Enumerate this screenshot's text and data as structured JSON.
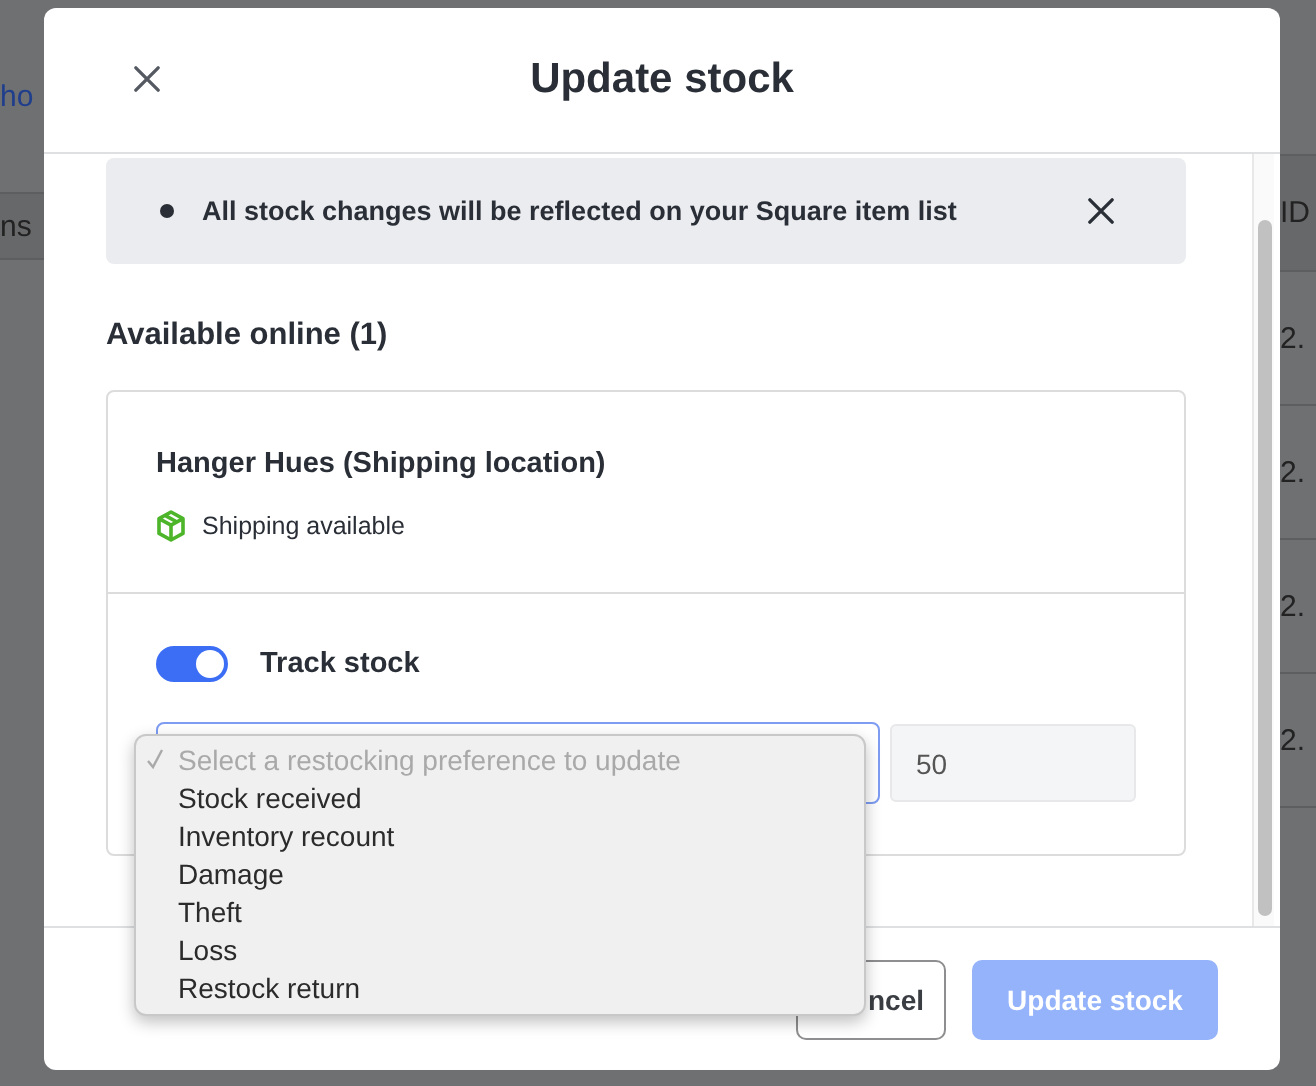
{
  "background_page": {
    "left": [
      {
        "text": "ho",
        "kind": "link"
      },
      {
        "text": "ns",
        "kind": "header"
      }
    ],
    "right": [
      {
        "text": "ID",
        "kind": "header"
      },
      {
        "text": "2.",
        "kind": "cell"
      },
      {
        "text": "2.",
        "kind": "cell"
      },
      {
        "text": "2.",
        "kind": "cell"
      },
      {
        "text": "2.",
        "kind": "cell"
      }
    ]
  },
  "dialog": {
    "title": "Update stock",
    "notice": "All stock changes will be reflected on your Square item list",
    "section_title": "Available online (1)",
    "location": {
      "name": "Hanger Hues (Shipping location)",
      "shipping": "Shipping available"
    },
    "track_stock": {
      "label": "Track stock",
      "on": true
    },
    "restock_select": {
      "expanded": true,
      "options": [
        {
          "label": "Select a restocking preference to update",
          "selected": true,
          "disabled": true
        },
        {
          "label": "Stock received",
          "selected": false,
          "disabled": false
        },
        {
          "label": "Inventory recount",
          "selected": false,
          "disabled": false
        },
        {
          "label": "Damage",
          "selected": false,
          "disabled": false
        },
        {
          "label": "Theft",
          "selected": false,
          "disabled": false
        },
        {
          "label": "Loss",
          "selected": false,
          "disabled": false
        },
        {
          "label": "Restock return",
          "selected": false,
          "disabled": false
        }
      ]
    },
    "quantity": {
      "value": "50"
    },
    "buttons": [
      {
        "label": "ncel",
        "kind": "secondary"
      },
      {
        "label": "Update stock",
        "kind": "primary",
        "disabled": true
      }
    ]
  }
}
